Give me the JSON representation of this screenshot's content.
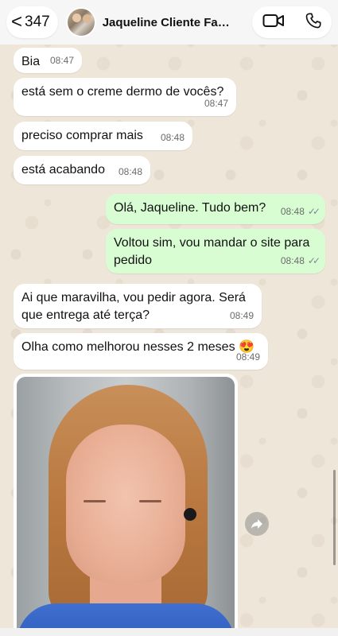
{
  "header": {
    "back_chevron": "<",
    "unread_count": "347",
    "contact_name": "Jaqueline Cliente Farm...",
    "video_icon": "video-camera-icon",
    "call_icon": "phone-icon"
  },
  "messages": [
    {
      "direction": "in",
      "text": "Bia",
      "time": "08:47"
    },
    {
      "direction": "in",
      "text": "está sem o creme dermo de vocês?",
      "time": "08:47"
    },
    {
      "direction": "in",
      "text": "preciso comprar mais",
      "time": "08:48"
    },
    {
      "direction": "in",
      "text": "está acabando",
      "time": "08:48"
    },
    {
      "direction": "out",
      "text": "Olá, Jaqueline. Tudo bem?",
      "time": "08:48",
      "status": "read"
    },
    {
      "direction": "out",
      "text_line1": "Voltou sim, vou mandar o site para",
      "text_line2": "pedido",
      "time": "08:48",
      "status": "read"
    },
    {
      "direction": "in",
      "text_line1": "Ai que maravilha, vou pedir agora. Será",
      "text_line2": "que entrega até terça?",
      "time": "08:49"
    },
    {
      "direction": "in",
      "text": "Olha como melhorou nesses 2 meses 😍",
      "time": "08:49"
    },
    {
      "direction": "in",
      "type": "photo",
      "icon": "face-photo"
    }
  ],
  "colors": {
    "incoming_bubble": "#ffffff",
    "outgoing_bubble": "#d9fdd3",
    "read_ticks": "#7b8a8f"
  }
}
